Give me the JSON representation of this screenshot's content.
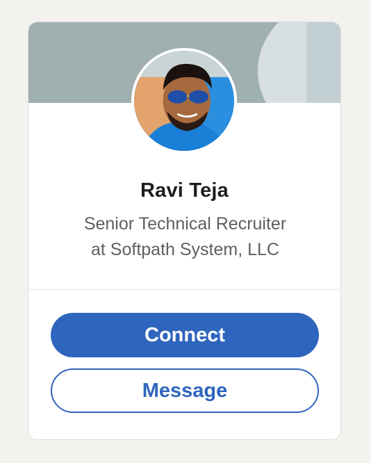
{
  "profile": {
    "name": "Ravi Teja",
    "headline_line1": "Senior Technical Recruiter",
    "headline_line2": "at Softpath System, LLC"
  },
  "actions": {
    "connect_label": "Connect",
    "message_label": "Message"
  },
  "colors": {
    "page_background": "#f3f2ef",
    "primary_blue": "#2e65bd",
    "banner": "#a0afb0"
  }
}
